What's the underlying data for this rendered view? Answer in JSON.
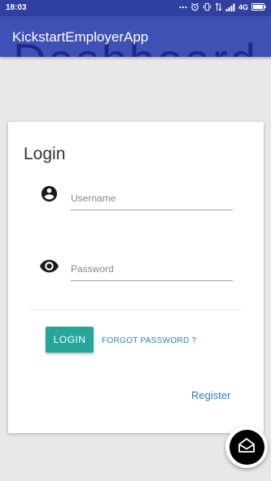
{
  "status_bar": {
    "time": "18:03",
    "network": "4G"
  },
  "app_bar": {
    "title": "KickstartEmployerApp",
    "background_heading": "Dashboard"
  },
  "login_card": {
    "title": "Login",
    "username": {
      "value": "",
      "placeholder": "Username",
      "icon": "account-circle-icon"
    },
    "password": {
      "value": "",
      "placeholder": "Password",
      "icon": "eye-icon"
    },
    "login_label": "LOGIN",
    "forgot_label": "FORGOT PASSWORD ?",
    "register_label": "Register"
  },
  "fab": {
    "icon": "open-envelope-icon"
  },
  "colors": {
    "app_bar": "#3f51b5",
    "status_bar": "#3040a0",
    "login_button": "#26a69a",
    "link": "#2980c5",
    "page_background": "#e8e8e8"
  }
}
